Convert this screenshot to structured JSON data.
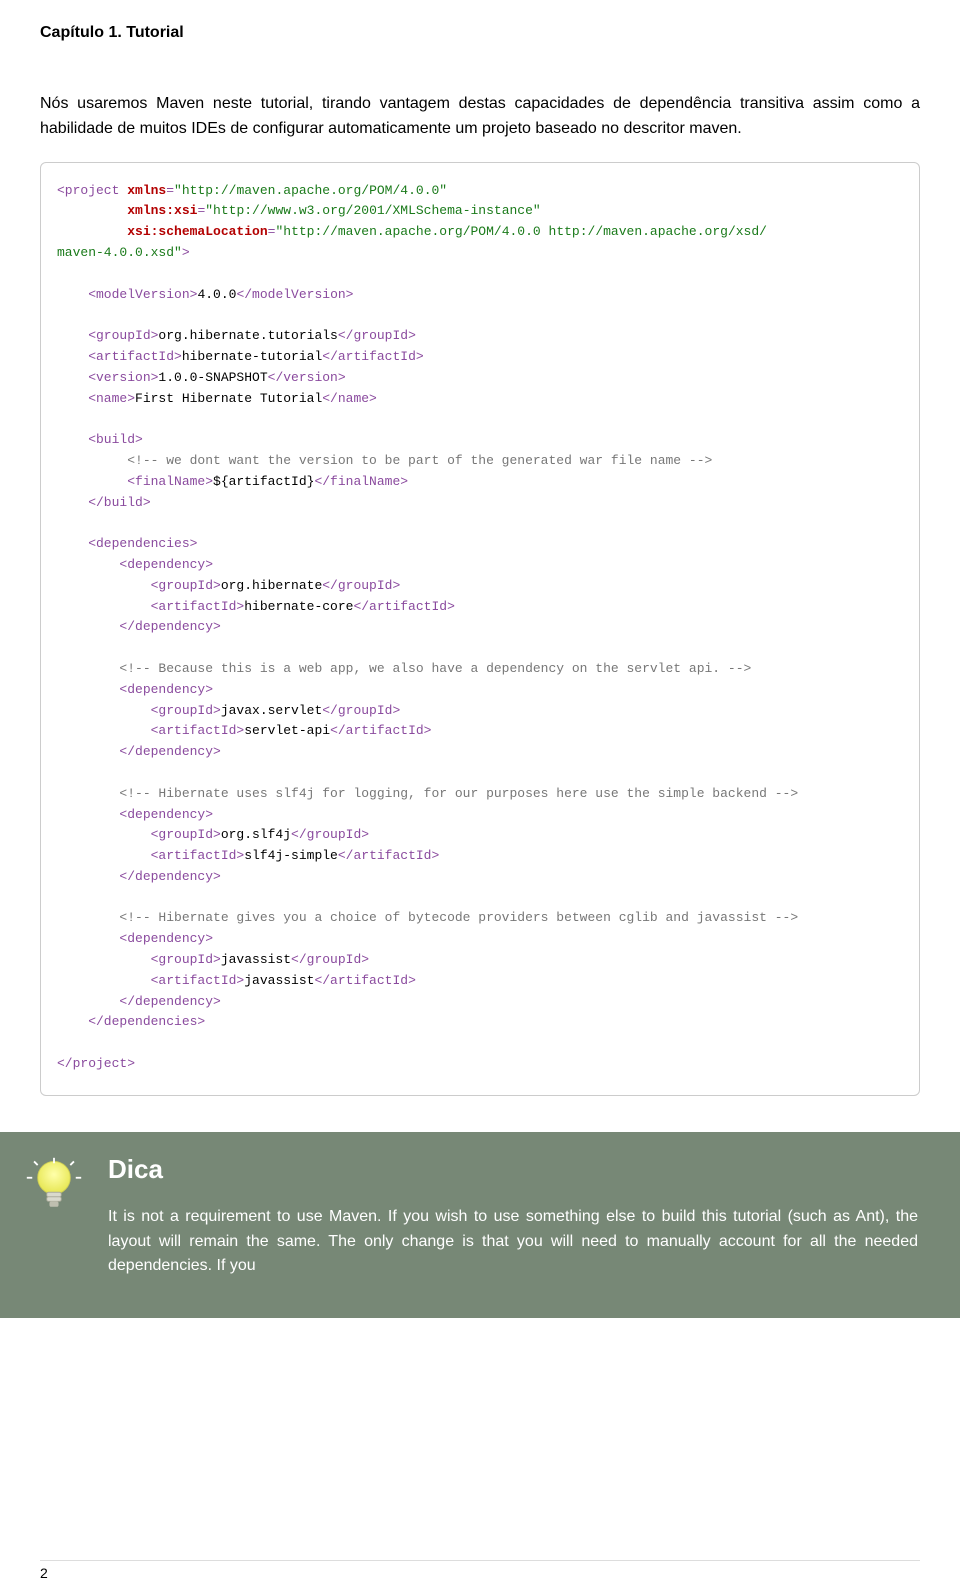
{
  "header": {
    "chapter_title": "Capítulo 1. Tutorial"
  },
  "intro": {
    "text": "Nós usaremos Maven neste tutorial, tirando vantagem destas capacidades de dependência transitiva assim como a habilidade de muitos IDEs de configurar automaticamente um projeto baseado no descritor maven."
  },
  "code": {
    "l1a": "<project ",
    "l1b": "xmlns",
    "l1c": "=",
    "l1d": "\"http://maven.apache.org/POM/4.0.0\"",
    "l2a": "         ",
    "l2b": "xmlns:xsi",
    "l2c": "=",
    "l2d": "\"http://www.w3.org/2001/XMLSchema-instance\"",
    "l3a": "         ",
    "l3b": "xsi:schemaLocation",
    "l3c": "=",
    "l3d": "\"http://maven.apache.org/POM/4.0.0 http://maven.apache.org/xsd/",
    "l4a": "maven-4.0.0.xsd\"",
    "l4b": ">",
    "blank1": "",
    "l5a": "    <modelVersion>",
    "l5b": "4.0.0",
    "l5c": "</modelVersion>",
    "blank2": "",
    "l6a": "    <groupId>",
    "l6b": "org.hibernate.tutorials",
    "l6c": "</groupId>",
    "l7a": "    <artifactId>",
    "l7b": "hibernate-tutorial",
    "l7c": "</artifactId>",
    "l8a": "    <version>",
    "l8b": "1.0.0-SNAPSHOT",
    "l8c": "</version>",
    "l9a": "    <name>",
    "l9b": "First Hibernate Tutorial",
    "l9c": "</name>",
    "blank3": "",
    "l10": "    <build>",
    "l11": "         <!-- we dont want the version to be part of the generated war file name -->",
    "l12a": "         <finalName>",
    "l12b": "${artifactId}",
    "l12c": "</finalName>",
    "l13": "    </build>",
    "blank4": "",
    "l14": "    <dependencies>",
    "l15": "        <dependency>",
    "l16a": "            <groupId>",
    "l16b": "org.hibernate",
    "l16c": "</groupId>",
    "l17a": "            <artifactId>",
    "l17b": "hibernate-core",
    "l17c": "</artifactId>",
    "l18": "        </dependency>",
    "blank5": "",
    "l19": "        <!-- Because this is a web app, we also have a dependency on the servlet api. -->",
    "l20": "        <dependency>",
    "l21a": "            <groupId>",
    "l21b": "javax.servlet",
    "l21c": "</groupId>",
    "l22a": "            <artifactId>",
    "l22b": "servlet-api",
    "l22c": "</artifactId>",
    "l23": "        </dependency>",
    "blank6": "",
    "l24": "        <!-- Hibernate uses slf4j for logging, for our purposes here use the simple backend -->",
    "l25": "        <dependency>",
    "l26a": "            <groupId>",
    "l26b": "org.slf4j",
    "l26c": "</groupId>",
    "l27a": "            <artifactId>",
    "l27b": "slf4j-simple",
    "l27c": "</artifactId>",
    "l28": "        </dependency>",
    "blank7": "",
    "l29": "        <!-- Hibernate gives you a choice of bytecode providers between cglib and javassist -->",
    "l30": "        <dependency>",
    "l31a": "            <groupId>",
    "l31b": "javassist",
    "l31c": "</groupId>",
    "l32a": "            <artifactId>",
    "l32b": "javassist",
    "l32c": "</artifactId>",
    "l33": "        </dependency>",
    "l34": "    </dependencies>",
    "blank8": "",
    "l35": "</project>"
  },
  "tip": {
    "title": "Dica",
    "body": "It is not a requirement to use Maven. If you wish to use something else to build this tutorial (such as Ant), the layout will remain the same. The only change is that you will need to manually account for all the needed dependencies. If you"
  },
  "footer": {
    "page_number": "2"
  }
}
